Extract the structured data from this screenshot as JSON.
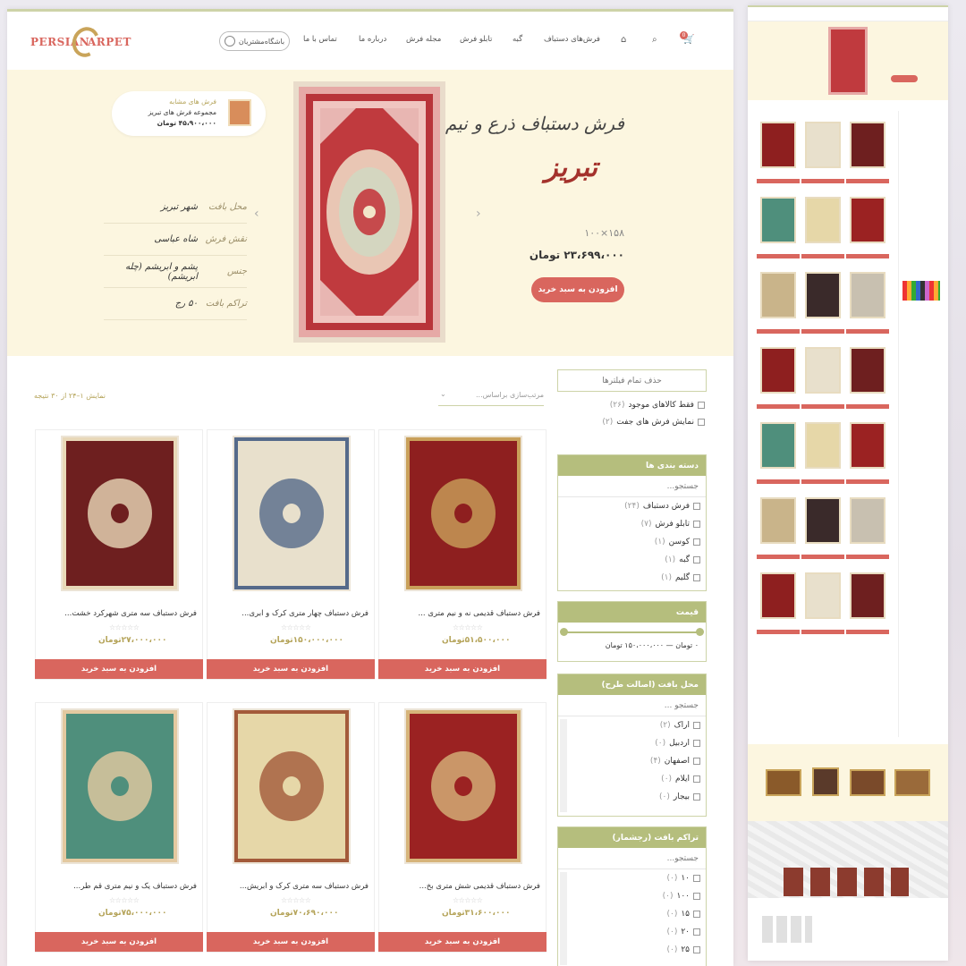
{
  "header": {
    "logo_left": "PERSIAN",
    "logo_right": "ARPET",
    "club_button": "باشگاه‌مشتریان",
    "cart_badge": "0",
    "nav": [
      "فرش‌های دستباف",
      "گبه",
      "تابلو فرش",
      "مجله فرش",
      "درباره ما",
      "تماس با ما"
    ]
  },
  "hero": {
    "related_label": "فرش های مشابه",
    "related_name": "مجموعه فرش های تبریز",
    "related_price": "۴۵،۹۰۰،۰۰۰ تومان",
    "title": "فرش دستباف ذرع و نیم",
    "title_city": "تبریز",
    "size": "۱۰۰×۱۵۸",
    "price": "۲۳،۶۹۹،۰۰۰ تومان",
    "button": "افزودن به سبد خرید",
    "specs": [
      {
        "k": "محل بافت",
        "v": "شهر تبریز"
      },
      {
        "k": "نقش فرش",
        "v": "شاه عباسی"
      },
      {
        "k": "جنس",
        "v": "پشم و ابریشم (چله ابریشم)"
      },
      {
        "k": "تراکم بافت",
        "v": "۵۰ رج"
      }
    ]
  },
  "filters": {
    "clear": "حذف تمام فیلترها",
    "in_stock": "فقط کالاهای موجود",
    "in_stock_count": "(۲۶)",
    "pairs": "نمایش فرش های جفت",
    "pairs_count": "(۲)",
    "categories": {
      "title": "دسته بندی ها",
      "search": "جستجو...",
      "items": [
        {
          "n": "فرش دستباف",
          "c": "(۲۴)"
        },
        {
          "n": "تابلو فرش",
          "c": "(۷)"
        },
        {
          "n": "کوسن",
          "c": "(۱)"
        },
        {
          "n": "گبه",
          "c": "(۱)"
        },
        {
          "n": "گلیم",
          "c": "(۱)"
        }
      ]
    },
    "price": {
      "title": "قیمت",
      "range": "۰ تومان — ۱۵۰،۰۰۰،۰۰۰ تومان",
      "min_fraction": 0.0,
      "max_fraction": 1.0
    },
    "place": {
      "title": "محل بافت (اصالت طرح)",
      "search": "جستجو ...",
      "items": [
        {
          "n": "اراک",
          "c": "(۲)"
        },
        {
          "n": "اردبیل",
          "c": "(۰)"
        },
        {
          "n": "اصفهان",
          "c": "(۴)"
        },
        {
          "n": "ایلام",
          "c": "(۰)"
        },
        {
          "n": "بیجار",
          "c": "(۰)"
        }
      ]
    },
    "density": {
      "title": "تراکم بافت (رجشمار)",
      "search": "جستجو...",
      "items": [
        {
          "n": "۱۰",
          "c": "(۰)"
        },
        {
          "n": "۱۰۰",
          "c": "(۰)"
        },
        {
          "n": "۱۵",
          "c": "(۰)"
        },
        {
          "n": "۲۰",
          "c": "(۰)"
        },
        {
          "n": "۲۵",
          "c": "(۰)"
        }
      ]
    }
  },
  "toolbar": {
    "sort": "مرتب‌سازی براساس...",
    "count": "نمایش ۱–۲۴ از ۳۰ نتیجه"
  },
  "products": [
    {
      "title": "فرش دستباف قدیمی نه و نیم متری ...",
      "price": "۵۱،۵۰۰،۰۰۰تومان",
      "bg": "#8e1f1f",
      "fg": "#c9a05a"
    },
    {
      "title": "فرش دستباف چهار متری کرک و ابری...",
      "price": "۱۵۰،۰۰۰،۰۰۰تومان",
      "bg": "#e8e0cc",
      "fg": "#556a8a"
    },
    {
      "title": "فرش دستباف سه متری شهرکرد خشت...",
      "price": "۲۷،۰۰۰،۰۰۰تومان",
      "bg": "#6e1f1f",
      "fg": "#e8d8b8"
    },
    {
      "title": "فرش دستباف قدیمی شش متری بخ...",
      "price": "۳۱،۶۰۰،۰۰۰تومان",
      "bg": "#9b2222",
      "fg": "#d6b47a"
    },
    {
      "title": "فرش دستباف سه متری کرک و ابریش...",
      "price": "۷۰،۶۹۰،۰۰۰تومان",
      "bg": "#e6d7a8",
      "fg": "#a35a3a"
    },
    {
      "title": "فرش دستباف یک و نیم متری قم طر...",
      "price": "۷۵،۰۰۰،۰۰۰تومان",
      "bg": "#4f8f7c",
      "fg": "#e3c9a0"
    }
  ],
  "add_label": "افزودن به سبد خرید",
  "colors": {
    "accent": "#d9665e",
    "olive": "#b5be7d",
    "cream": "#fcf6e0",
    "price": "#b5a45a"
  }
}
